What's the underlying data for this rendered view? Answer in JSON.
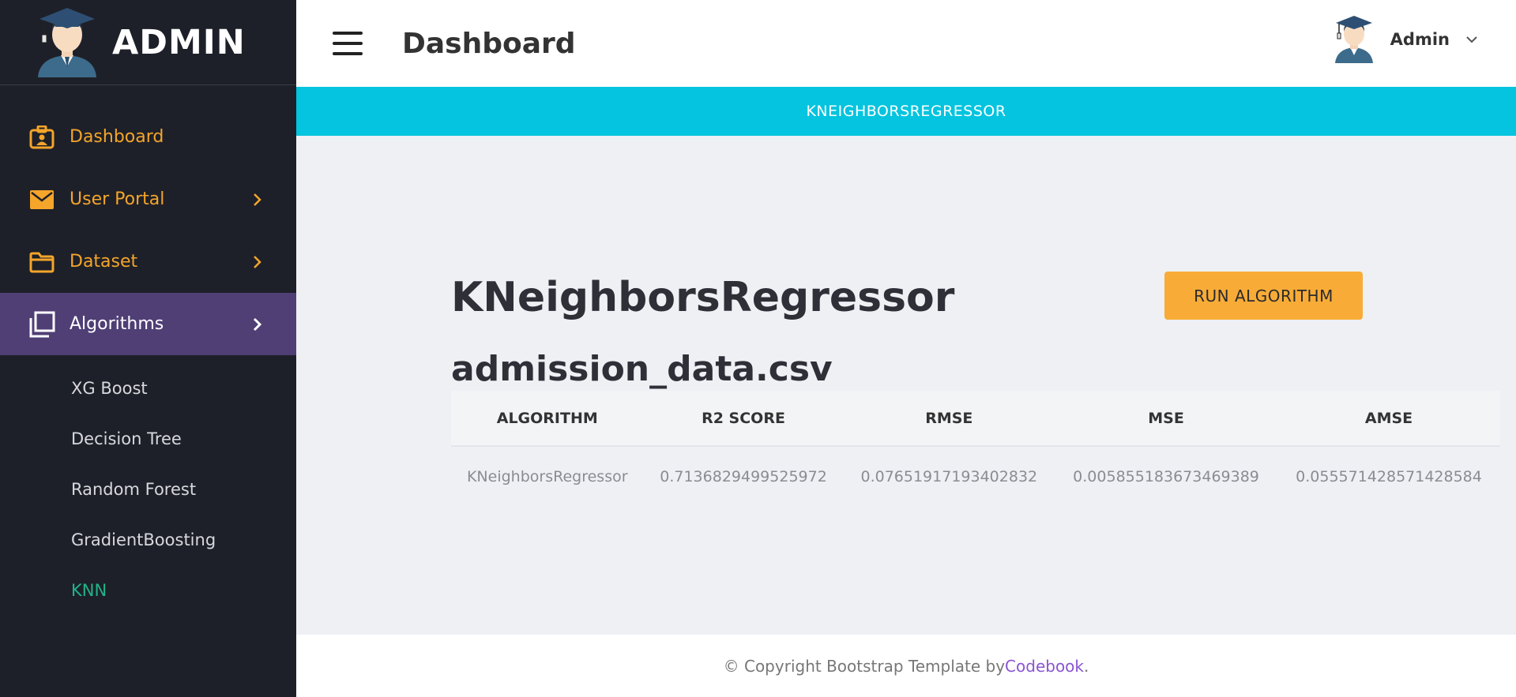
{
  "brand": {
    "title": "ADMIN"
  },
  "sidebar": {
    "items": [
      {
        "label": "Dashboard",
        "icon": "id-badge-icon",
        "active": false
      },
      {
        "label": "User Portal",
        "icon": "envelope-icon",
        "active": false
      },
      {
        "label": "Dataset",
        "icon": "folder-icon",
        "active": false
      },
      {
        "label": "Algorithms",
        "icon": "copy-icon",
        "active": true
      }
    ],
    "sub_items": [
      "XG Boost",
      "Decision Tree",
      "Random Forest",
      "GradientBoosting",
      "KNN"
    ],
    "current_sub_item": "KNN"
  },
  "topbar": {
    "title": "Dashboard",
    "user_name": "Admin"
  },
  "banner": {
    "text": "KNEIGHBORSREGRESSOR"
  },
  "main": {
    "algorithm_title": "KNeighborsRegressor",
    "run_button": "RUN ALGORITHM",
    "dataset": "admission_data.csv",
    "table": {
      "headers": [
        "ALGORITHM",
        "R2 SCORE",
        "RMSE",
        "MSE",
        "AMSE"
      ],
      "rows": [
        [
          "KNeighborsRegressor",
          "0.7136829499525972",
          "0.07651917193402832",
          "0.005855183673469389",
          "0.055571428571428584"
        ]
      ]
    }
  },
  "footer": {
    "prefix": "© Copyright Bootstrap Template by ",
    "link": "Codebook",
    "suffix": "."
  },
  "colors": {
    "sidebar_bg": "#1e2029",
    "active_item_bg": "#4f3f75",
    "accent_orange": "#f4a52a",
    "banner_cyan": "#04c4df",
    "button_orange": "#f8ac37",
    "current_green": "#1fb48a",
    "link_purple": "#8a55d1"
  }
}
